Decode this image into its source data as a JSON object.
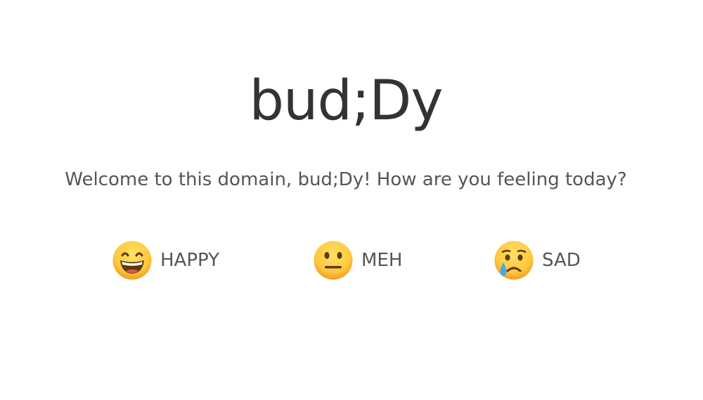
{
  "header": {
    "title": "bud;Dy",
    "subtitle": "Welcome to this domain, bud;Dy! How are you feeling today?"
  },
  "moods": [
    {
      "label": "HAPPY",
      "icon": "grinning-face-icon"
    },
    {
      "label": "MEH",
      "icon": "neutral-face-icon"
    },
    {
      "label": "SAD",
      "icon": "crying-face-icon"
    }
  ],
  "colors": {
    "background": "#ffffff",
    "title_text": "#333333",
    "body_text": "#555555",
    "emoji_face": "#ffc83d",
    "emoji_outline": "#f29c1f",
    "tear": "#4aa8ea"
  }
}
